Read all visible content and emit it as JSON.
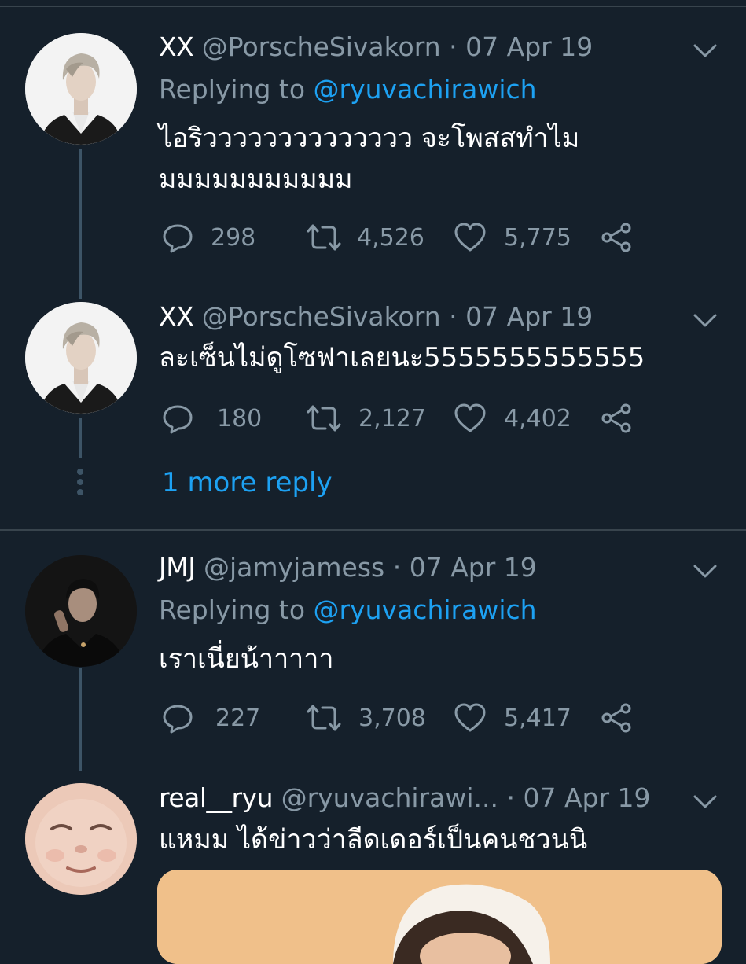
{
  "colors": {
    "background": "#15202b",
    "text_primary": "#ffffff",
    "text_secondary": "#8899a6",
    "link": "#1da1f2",
    "thread_line": "#3d5466"
  },
  "tweets": [
    {
      "name": "XX",
      "handle": "@PorscheSivakorn",
      "separator": "·",
      "date": "07 Apr 19",
      "replying_prefix": "Replying to",
      "replying_to": "@ryuvachirawich",
      "text": "ไอริวววววววววววววว จะโพสสทำไมมมมมมมมมมมม",
      "replies": "298",
      "retweets": "4,526",
      "likes": "5,775"
    },
    {
      "name": "XX",
      "handle": "@PorscheSivakorn",
      "separator": "·",
      "date": "07 Apr 19",
      "text": "ละเซ็นไม่ดูโซฟาเลยนะ5555555555555",
      "replies": "180",
      "retweets": "2,127",
      "likes": "4,402"
    },
    {
      "name": "JMJ",
      "handle": "@jamyjamess",
      "separator": "·",
      "date": "07 Apr 19",
      "replying_prefix": "Replying to",
      "replying_to": "@ryuvachirawich",
      "text": "เราเนี่ยน้าาาาา",
      "replies": "227",
      "retweets": "3,708",
      "likes": "5,417"
    },
    {
      "name": "real__ryu",
      "handle": "@ryuvachirawi...",
      "separator": "·",
      "date": "07 Apr 19",
      "text": "แหมม ได้ข่าวว่าลีดเดอร์เป็นคนชวนนิ"
    }
  ],
  "more_reply": "1 more reply",
  "icons": [
    "reply-icon",
    "retweet-icon",
    "like-icon",
    "share-icon",
    "chevron-down-icon"
  ]
}
